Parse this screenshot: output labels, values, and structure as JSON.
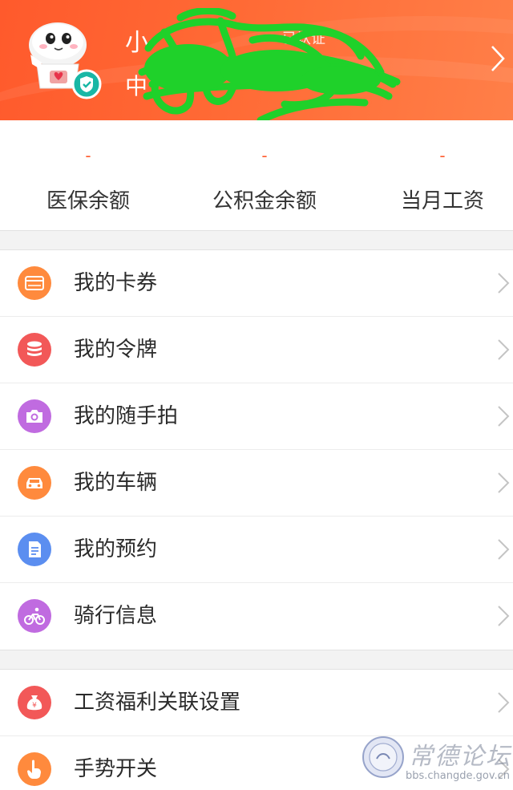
{
  "header": {
    "user_name": "小",
    "verified_label": "已认证",
    "org_text": "中",
    "colors": {
      "bg": "#ff5a2c",
      "bg_end": "#ff7f48",
      "badge": "#19b7a5"
    }
  },
  "stats": [
    {
      "value": "-",
      "label": "医保余额"
    },
    {
      "value": "-",
      "label": "公积金余额"
    },
    {
      "value": "-",
      "label": "当月工资"
    }
  ],
  "menu_primary": [
    {
      "label": "我的卡券",
      "icon": "card-icon",
      "color": "#ff8a3d"
    },
    {
      "label": "我的令牌",
      "icon": "token-icon",
      "color": "#f25858"
    },
    {
      "label": "我的随手拍",
      "icon": "camera-icon",
      "color": "#c06be0"
    },
    {
      "label": "我的车辆",
      "icon": "car-icon",
      "color": "#ff8a3d"
    },
    {
      "label": "我的预约",
      "icon": "document-icon",
      "color": "#5b8ef0"
    },
    {
      "label": "骑行信息",
      "icon": "bicycle-icon",
      "color": "#c06be0"
    }
  ],
  "menu_secondary": [
    {
      "label": "工资福利关联设置",
      "icon": "money-bag-icon",
      "color": "#f25858"
    },
    {
      "label": "手势开关",
      "icon": "gesture-icon",
      "color": "#ff8a3d"
    }
  ],
  "watermark": {
    "title": "常德论坛",
    "url": "bbs.changde.gov.cn"
  }
}
